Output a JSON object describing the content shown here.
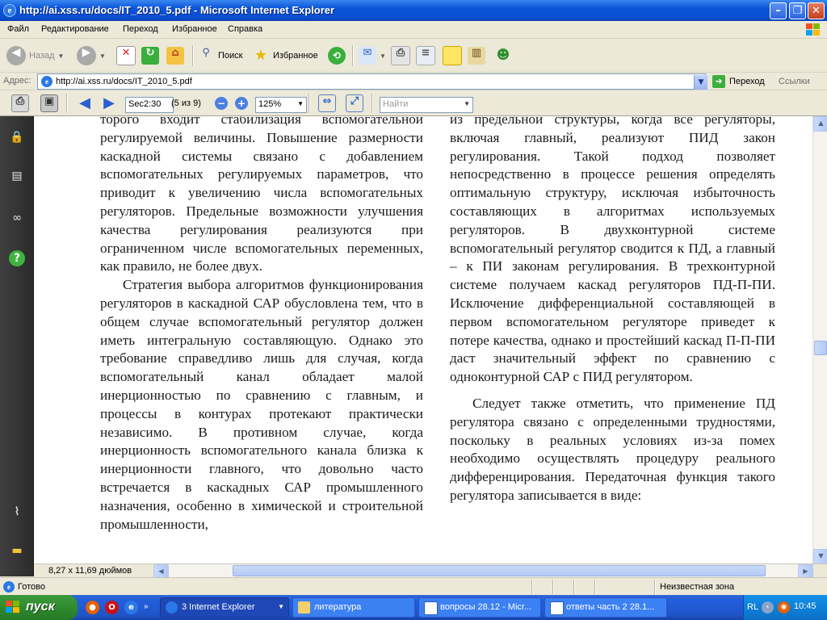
{
  "window": {
    "title": "http://ai.xss.ru/docs/IT_2010_5.pdf - Microsoft Internet Explorer",
    "minimize_glyph": "–",
    "maximize_glyph": "❐",
    "close_glyph": "✕"
  },
  "menu": [
    "Файл",
    "Редактирование",
    "Переход",
    "Избранное",
    "Справка"
  ],
  "toolbar": {
    "back_label": "Назад",
    "search_label": "Поиск",
    "favorites_label": "Избранное"
  },
  "address": {
    "label": "Адрес:",
    "url": "http://ai.xss.ru/docs/IT_2010_5.pdf",
    "go_label": "Переход",
    "links_label": "Ссылки"
  },
  "pdf_toolbar": {
    "page_label": "Sec2:30",
    "page_count": "(5 из 9)",
    "zoom": "125%",
    "find_placeholder": "Найти"
  },
  "document": {
    "page_size": "8,27 x 11,69 дюймов",
    "left_column": [
      {
        "indent": false,
        "text": "торого входит стабилизация вспомогательной регулируемой величины. Повышение размерности каскадной системы связано с добавлением вспомогательных регулируемых параметров, что приводит к увеличению числа вспомогательных регуляторов. Предельные возможности улучшения качества регулирования реализуются при ограниченном числе вспомогательных переменных, как правило, не более двух."
      },
      {
        "indent": true,
        "text": "Стратегия выбора алгоритмов функционирования регуляторов в каскадной САР обусловлена тем, что в общем случае вспомогательный регулятор должен иметь интегральную составляющую. Однако это требование справедливо лишь для случая, когда вспомогательный канал обладает малой инерционностью по сравнению с главным, и процессы в контурах протекают практически независимо. В противном случае, когда инерционность вспомогательного канала близка к инерционности главного, что довольно часто встречается в каскадных САР промышленного назначения, особенно в химической и строительной промышленности,"
      }
    ],
    "right_column": [
      {
        "indent": false,
        "text": "из предельной структуры, когда все регуляторы, включая главный, реализуют ПИД закон регулирования. Такой подход позволяет непосредственно в процессе решения определять оптимальную структуру, исключая избыточность составляющих в алгоритмах используемых регуляторов. В двухконтурной системе вспомогательный регулятор сводится к ПД, а главный – к ПИ законам регулирования. В трехконтурной системе получаем каскад регуляторов ПД-П-ПИ. Исключение дифференциальной составляющей в первом вспомогательном регуляторе приведет к потере качества, однако и простейший каскад П-П-ПИ даст значительный эффект по сравнению с одноконтурной САР с ПИД регулятором."
      },
      {
        "indent": true,
        "text": "Следует также отметить, что применение ПД регулятора связано с определенными трудностями, поскольку в реальных условиях из-за помех необходимо осуществлять процедуру реального дифференцирования. Передаточная функция такого регулятора записывается в виде:"
      }
    ]
  },
  "status": {
    "text": "Готово",
    "zone": "Неизвестная зона"
  },
  "taskbar": {
    "start_label": "пуск",
    "tasks": [
      {
        "label": "3 Internet Explorer",
        "active": true
      },
      {
        "label": "литература",
        "active": false
      },
      {
        "label": "вопросы 28.12 - Micr...",
        "active": false
      },
      {
        "label": "ответы часть 2 28.1...",
        "active": false
      }
    ],
    "lang": "RL",
    "clock": "10:45"
  },
  "colors": {
    "titlebar": "#0A54D9",
    "taskbar": "#245EDC",
    "start": "#2F8B2F",
    "tray": "#0E7FD8"
  }
}
